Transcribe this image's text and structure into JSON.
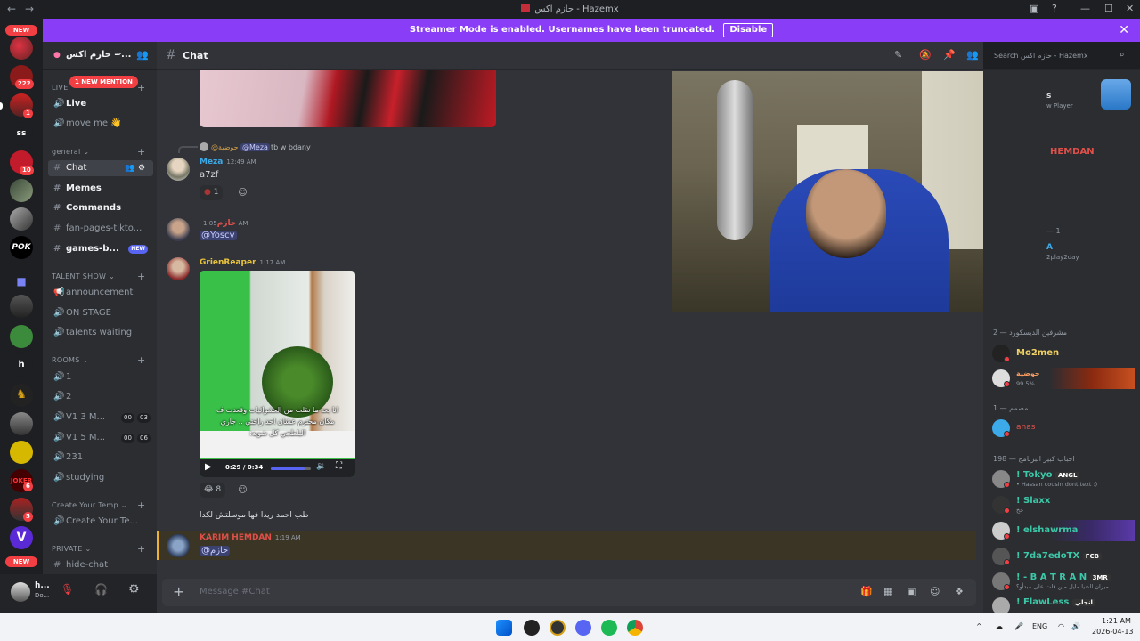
{
  "window": {
    "title": "حازم اكس - Hazemx",
    "back": "←",
    "forward": "→",
    "controls": [
      "—",
      "☐",
      "✕"
    ]
  },
  "banner": {
    "text": "Streamer Mode is enabled. Usernames have been truncated.",
    "disable_label": "Disable",
    "close": "✕",
    "color": "#8a3df6"
  },
  "rail": {
    "new_top": "NEW",
    "new_bottom": "NEW",
    "badges": [
      "222",
      "1",
      "10",
      "6",
      "5"
    ],
    "ss_label": "ss",
    "h_label": "h"
  },
  "sidebar": {
    "server_name": "حازم اكس - ...",
    "new_mention": "1 NEW MENTION",
    "categories": {
      "live": "LIVE",
      "general": "general",
      "talent": "TALENT SHOW",
      "rooms": "ROOMS",
      "create": "Create Your Temp",
      "private": "PRIVATE"
    },
    "channels": {
      "live": "Live",
      "move_me": "move me 👋",
      "chat": "Chat",
      "memes": "Memes",
      "commands": "Commands",
      "fan_pages": "fan-pages-tikto...",
      "games": "games-b...",
      "games_new": "NEW",
      "announcement": "announcement",
      "on_stage": "ON STAGE",
      "talents_waiting": "talents waiting",
      "room1": "1",
      "room2": "2",
      "v13": "V1 3 M...",
      "v13_a": "00",
      "v13_b": "03",
      "v15": "V1 5 M...",
      "v15_a": "00",
      "v15_b": "06",
      "r231": "231",
      "studying": "studying",
      "create_your": "Create Your Te...",
      "hide_chat": "hide-chat"
    }
  },
  "user": {
    "name": "h...",
    "status": "Do..."
  },
  "channel": {
    "name": "Chat",
    "search_placeholder": "Search حازم اكس - Hazemx"
  },
  "messages": {
    "reply_name": "@حوضية",
    "reply_mention": "@Meza",
    "reply_text": "tb w bdany",
    "m1_user": "Meza",
    "m1_time": "12:49 AM",
    "m1_text": "a7zf",
    "m1_react_count": "1",
    "m2_user": "حازم",
    "m2_time": "1:05 AM",
    "m2_text": "@Yoscv",
    "m3_user": "GrienReaper",
    "m3_time": "1:17 AM",
    "video_caption": "انا بعد ما نقلت من العشوائيات وقعدت ف مكان محترم عشان احد راحتي .. جاري البلطجي كل شويه:",
    "video_time": "0:29 / 0:34",
    "m3_react_count": "8",
    "m3_text": "طب احمد ريدا فها موسلتش لكدا",
    "m4_user": "KARIM HEMDAN",
    "m4_time": "1:19 AM",
    "m4_text": "@حازم",
    "composer_placeholder": "Message #Chat"
  },
  "members": {
    "now_playing": "s",
    "now_playing_sub": "w Player",
    "top_name": "HEMDAN",
    "cat_dash1": "— 1",
    "mem_a": "A",
    "mem_a_sub": "2play2day",
    "cat_mods": "مشرفين الديسكورد — 2",
    "mo2men": "Mo2men",
    "hawdaya": "حوضية",
    "hawdaya_sub": "99.5%",
    "cat_designer": "مصمم — 1",
    "anas": "anas",
    "cat_fans": "احباب كبير البرنامج — 198",
    "tokyo": "! Tokyo",
    "tokyo_tag": "ANGL",
    "tokyo_sub": "• Hassan cousin dont text :)",
    "slaxx": "! Slaxx",
    "slaxx_sub": "خخ",
    "elshawrma": "! elshawrma",
    "d7da7edo": "! 7da7edoTX",
    "d7da7edo_tag": "FCB",
    "batran": "! - B A T R A N",
    "batran_tag": "3MR",
    "batran_sub": "ميزان الدنيا مايل مين قلت على مبدأو؟",
    "flawless": "! FlawLess",
    "flawless_tag": "انجلي"
  },
  "taskbar": {
    "lang": "ENG",
    "time": "1:21 AM",
    "date": "2026-04-13"
  }
}
